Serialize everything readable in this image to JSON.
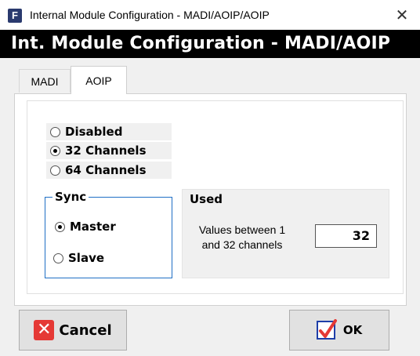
{
  "window": {
    "app_icon_letter": "F",
    "title": "Internal Module Configuration - MADI/AOIP/AOIP",
    "close_glyph": "✕"
  },
  "banner": {
    "text": "Int. Module Configuration - MADI/AOIP"
  },
  "tabs": [
    {
      "label": "MADI",
      "selected": false
    },
    {
      "label": "AOIP",
      "selected": true
    }
  ],
  "channels": {
    "options": [
      {
        "label": "Disabled",
        "checked": false
      },
      {
        "label": "32 Channels",
        "checked": true
      },
      {
        "label": "64 Channels",
        "checked": false
      }
    ]
  },
  "sync": {
    "title": "Sync",
    "options": [
      {
        "label": "Master",
        "checked": true
      },
      {
        "label": "Slave",
        "checked": false
      }
    ]
  },
  "used": {
    "title": "Used",
    "description": "Values between 1 and 32 channels",
    "value": "32"
  },
  "buttons": {
    "cancel": {
      "label": "Cancel",
      "icon": "x-icon"
    },
    "ok": {
      "label": "OK",
      "icon": "check-icon"
    }
  },
  "colors": {
    "sync_border": "#1f6fc5",
    "cancel_icon": "#e53935",
    "ok_icon": "#1e3ea8",
    "banner_bg": "#000000"
  }
}
